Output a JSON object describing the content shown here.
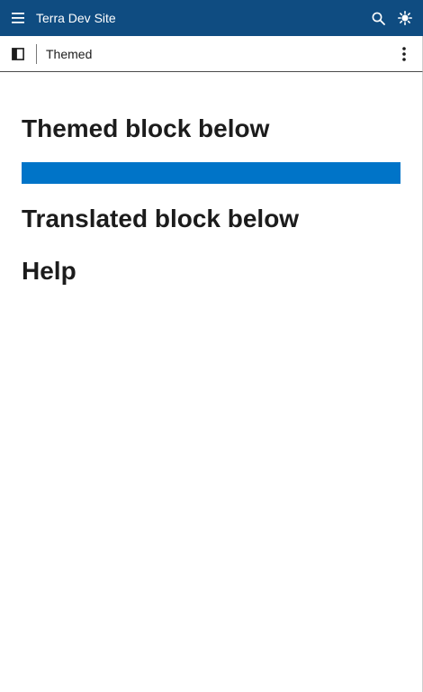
{
  "header": {
    "site_title": "Terra Dev Site",
    "icons": [
      "hamburger-menu-icon",
      "search-icon",
      "theme-toggle-icon"
    ]
  },
  "toolbar": {
    "page_label": "Themed",
    "icons": [
      "sidebar-panel-icon",
      "kebab-menu-icon"
    ]
  },
  "main": {
    "headings": {
      "themed": "Themed block below",
      "translated": "Translated block below",
      "help": "Help"
    },
    "themed_block_color": "#0074c8"
  },
  "colors": {
    "header_bg": "#0f4c81",
    "accent": "#0074c8"
  }
}
